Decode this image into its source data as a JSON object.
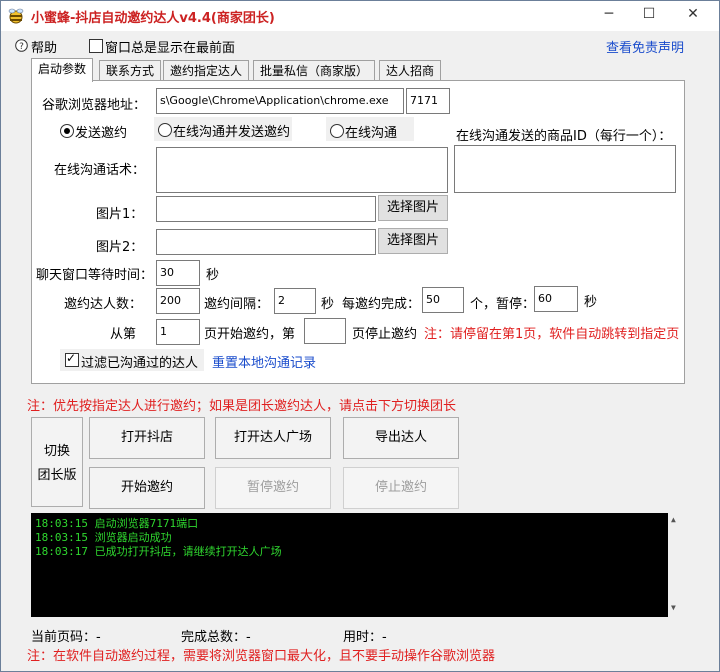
{
  "title": "小蜜蜂-抖店自动邀约达人v4.4(商家团长)",
  "window_controls": {
    "min": "─",
    "max": "☐",
    "close": "✕"
  },
  "menu": {
    "help": "帮助",
    "topmost": "窗口总是显示在最前面",
    "disclaimer": "查看免责声明",
    "topmost_checked": false
  },
  "tabs": [
    "启动参数",
    "联系方式",
    "邀约指定达人",
    "批量私信（商家版）",
    "达人招商"
  ],
  "form": {
    "chrome_label": "谷歌浏览器地址：",
    "chrome_path": "s\\Google\\Chrome\\Application\\chrome.exe",
    "port": "7171",
    "radio_invite": "发送邀约",
    "radio_chat_invite": "在线沟通并发送邀约",
    "radio_chat": "在线沟通",
    "product_id_label": "在线沟通发送的商品ID（每行一个）：",
    "chat_script_label": "在线沟通话术：",
    "image1_label": "图片1：",
    "image2_label": "图片2：",
    "choose_image": "选择图片",
    "wait_label": "聊天窗口等待时间：",
    "wait_value": "30",
    "sec": "秒",
    "invite_count_label": "邀约达人数：",
    "invite_count": "200",
    "interval_label": "邀约间隔：",
    "interval": "2",
    "batch_label": "每邀约完成：",
    "batch": "50",
    "pause_label": "个，暂停：",
    "pause": "60",
    "from_label": "从第",
    "from_page": "1",
    "start_page_label": "页开始邀约，第",
    "end_page": "",
    "stop_page_label": "页停止邀约",
    "page_note": "注：请停留在第1页，软件自动跳转到指定页",
    "filter_label": "过滤已沟通过的达人",
    "filter_checked": true,
    "reset_link": "重置本地沟通记录"
  },
  "note_top": "注：优先按指定达人进行邀约；如果是团长邀约达人，请点击下方切换团长",
  "buttons": {
    "switch_line1": "切换",
    "switch_line2": "团长版",
    "open_store": "打开抖店",
    "open_plaza": "打开达人广场",
    "export": "导出达人",
    "start": "开始邀约",
    "pause": "暂停邀约",
    "stop": "停止邀约"
  },
  "log": [
    "18:03:15 启动浏览器7171端口",
    "18:03:15 浏览器启动成功",
    "18:03:17 已成功打开抖店，请继续打开达人广场"
  ],
  "status": {
    "page": "当前页码：-",
    "total": "完成总数：-",
    "time": "用时：-"
  },
  "note_bottom": "注：在软件自动邀约过程，需要将浏览器窗口最大化，且不要手动操作谷歌浏览器",
  "colors": {
    "note_red": "#e02020",
    "link_blue": "#1a4ccc",
    "log_green": "#2fd72f",
    "title_red": "#cc2222"
  }
}
